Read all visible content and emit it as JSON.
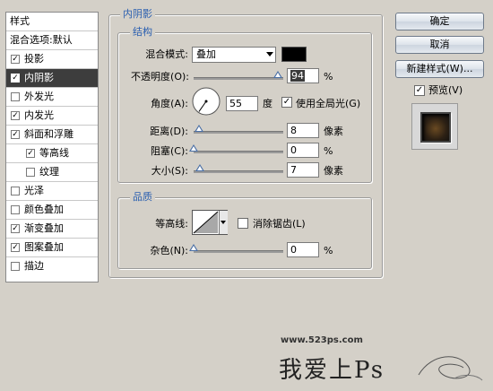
{
  "sidebar": {
    "items": [
      {
        "label": "样式",
        "checkbox": false,
        "checked": false,
        "selected": false
      },
      {
        "label": "混合选项:默认",
        "checkbox": false,
        "checked": false,
        "selected": false
      },
      {
        "label": "投影",
        "checkbox": true,
        "checked": true,
        "selected": false
      },
      {
        "label": "内阴影",
        "checkbox": true,
        "checked": true,
        "selected": true
      },
      {
        "label": "外发光",
        "checkbox": true,
        "checked": false,
        "selected": false
      },
      {
        "label": "内发光",
        "checkbox": true,
        "checked": true,
        "selected": false
      },
      {
        "label": "斜面和浮雕",
        "checkbox": true,
        "checked": true,
        "selected": false
      },
      {
        "label": "等高线",
        "checkbox": true,
        "checked": true,
        "selected": false,
        "indent": true
      },
      {
        "label": "纹理",
        "checkbox": true,
        "checked": false,
        "selected": false,
        "indent": true
      },
      {
        "label": "光泽",
        "checkbox": true,
        "checked": false,
        "selected": false
      },
      {
        "label": "颜色叠加",
        "checkbox": true,
        "checked": false,
        "selected": false
      },
      {
        "label": "渐变叠加",
        "checkbox": true,
        "checked": true,
        "selected": false
      },
      {
        "label": "图案叠加",
        "checkbox": true,
        "checked": true,
        "selected": false
      },
      {
        "label": "描边",
        "checkbox": true,
        "checked": false,
        "selected": false
      }
    ]
  },
  "panel": {
    "title": "内阴影",
    "structure": {
      "title": "结构",
      "blend_mode_label": "混合模式:",
      "blend_mode_value": "叠加",
      "blend_color": "#000000",
      "opacity_label": "不透明度(O):",
      "opacity_value": "94",
      "opacity_unit": "%",
      "opacity_level": 0.94,
      "angle_label": "角度(A):",
      "angle_value": "55",
      "angle_unit": "度",
      "global_light_label": "使用全局光(G)",
      "global_light_checked": true,
      "distance_label": "距离(D):",
      "distance_value": "8",
      "distance_unit": "像素",
      "choke_label": "阻塞(C):",
      "choke_value": "0",
      "choke_unit": "%",
      "size_label": "大小(S):",
      "size_value": "7",
      "size_unit": "像素"
    },
    "quality": {
      "title": "品质",
      "contour_label": "等高线:",
      "antialias_label": "消除锯齿(L)",
      "antialias_checked": false,
      "noise_label": "杂色(N):",
      "noise_value": "0",
      "noise_unit": "%"
    }
  },
  "buttons": {
    "ok": "确定",
    "cancel": "取消",
    "new_style": "新建样式(W)...",
    "preview_label": "预览(V)",
    "preview_checked": true
  },
  "watermark": {
    "url": "www.523ps.com",
    "text": "我爱上Ps"
  },
  "icons": {
    "check": "✓",
    "dropdown": "chevron-down-icon"
  }
}
